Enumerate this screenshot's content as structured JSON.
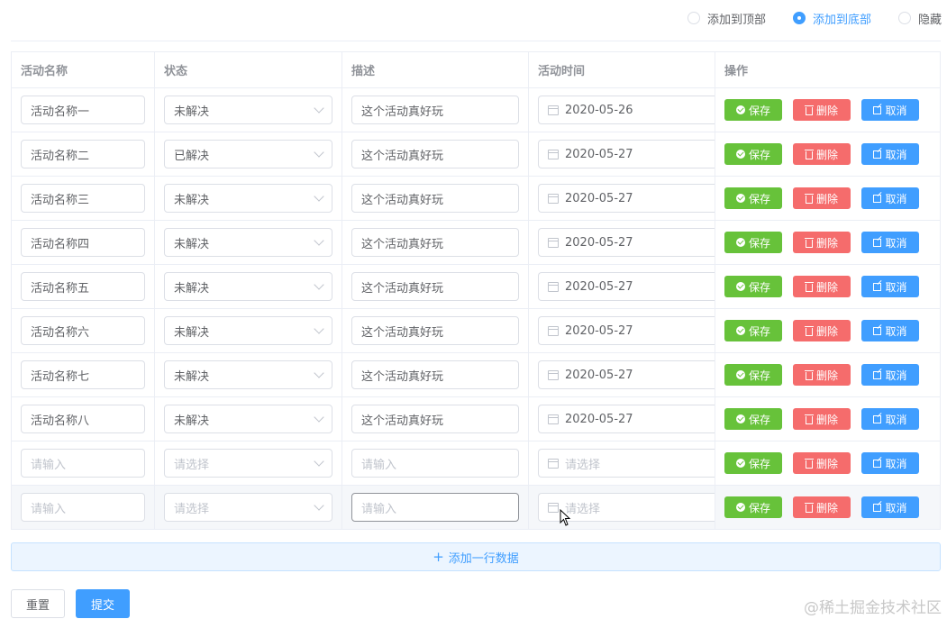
{
  "radio_group": {
    "options": [
      {
        "label": "添加到顶部",
        "checked": false
      },
      {
        "label": "添加到底部",
        "checked": true
      },
      {
        "label": "隐藏",
        "checked": false
      }
    ]
  },
  "table": {
    "headers": [
      "活动名称",
      "状态",
      "描述",
      "活动时间",
      "操作"
    ],
    "placeholders": {
      "name": "请输入",
      "status": "请选择",
      "desc": "请输入",
      "date": "请选择"
    },
    "rows": [
      {
        "name": "活动名称一",
        "status": "未解决",
        "desc": "这个活动真好玩",
        "date": "2020-05-26"
      },
      {
        "name": "活动名称二",
        "status": "已解决",
        "desc": "这个活动真好玩",
        "date": "2020-05-27"
      },
      {
        "name": "活动名称三",
        "status": "未解决",
        "desc": "这个活动真好玩",
        "date": "2020-05-27"
      },
      {
        "name": "活动名称四",
        "status": "未解决",
        "desc": "这个活动真好玩",
        "date": "2020-05-27"
      },
      {
        "name": "活动名称五",
        "status": "未解决",
        "desc": "这个活动真好玩",
        "date": "2020-05-27"
      },
      {
        "name": "活动名称六",
        "status": "未解决",
        "desc": "这个活动真好玩",
        "date": "2020-05-27"
      },
      {
        "name": "活动名称七",
        "status": "未解决",
        "desc": "这个活动真好玩",
        "date": "2020-05-27"
      },
      {
        "name": "活动名称八",
        "status": "未解决",
        "desc": "这个活动真好玩",
        "date": "2020-05-27"
      },
      {
        "name": "",
        "status": "",
        "desc": "",
        "date": ""
      },
      {
        "name": "",
        "status": "",
        "desc": "",
        "date": ""
      }
    ],
    "actions": {
      "save": "保存",
      "delete": "删除",
      "cancel": "取消"
    }
  },
  "add_row_label": "添加一行数据",
  "footer": {
    "reset": "重置",
    "submit": "提交"
  },
  "watermark": "@稀土掘金技术社区",
  "colors": {
    "primary": "#409eff",
    "success": "#67c23a",
    "danger": "#f56c6c"
  }
}
